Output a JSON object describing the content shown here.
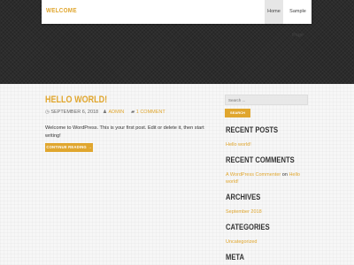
{
  "header": {
    "site_title": "WELCOME",
    "nav": [
      {
        "label": "Home",
        "active": true
      },
      {
        "label": "Sample Page",
        "active": false
      }
    ]
  },
  "post": {
    "title": "HELLO WORLD!",
    "date": "SEPTEMBER 6, 2018",
    "author": "ADMIN",
    "comments": "1 COMMENT",
    "excerpt": "Welcome to WordPress. This is your first post. Edit or delete it, then start writing!",
    "read_more": "CONTINUE READING →"
  },
  "sidebar": {
    "search": {
      "placeholder": "Search ...",
      "button": "SEARCH"
    },
    "recent_posts": {
      "title": "RECENT POSTS",
      "items": [
        "Hello world!"
      ]
    },
    "recent_comments": {
      "title": "RECENT COMMENTS",
      "author": "A WordPress Commenter",
      "on": "on",
      "post": "Hello world!"
    },
    "archives": {
      "title": "ARCHIVES",
      "items": [
        "September 2018"
      ]
    },
    "categories": {
      "title": "CATEGORIES",
      "items": [
        "Uncategorized"
      ]
    },
    "meta": {
      "title": "META"
    }
  },
  "colors": {
    "accent": "#e0a62e",
    "hero_bg": "#2c2c2c"
  },
  "icons": {
    "date": "clock-icon",
    "author": "user-icon",
    "comments": "comment-icon"
  }
}
